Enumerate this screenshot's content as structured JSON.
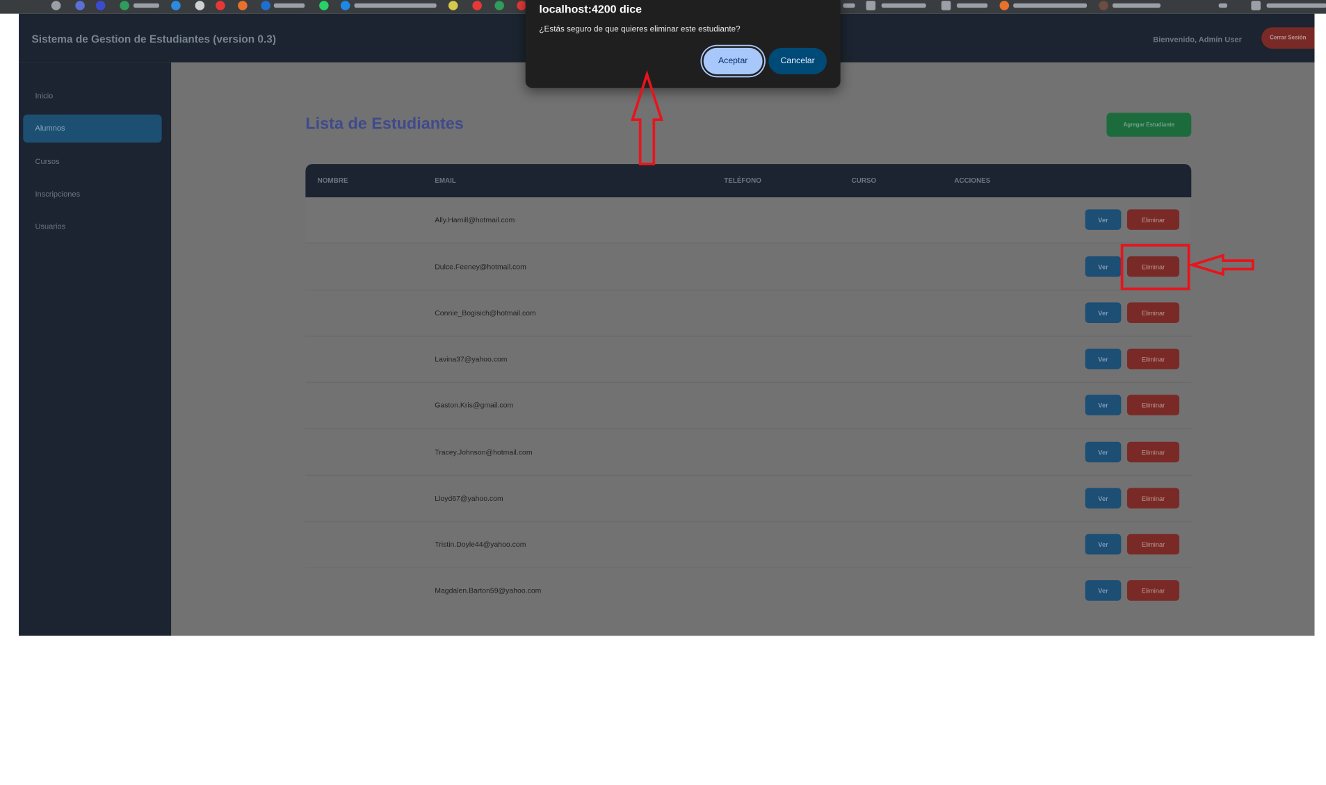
{
  "dialog": {
    "title": "localhost:4200 dice",
    "message": "¿Estás seguro de que quieres eliminar este estudiante?",
    "accept_label": "Aceptar",
    "cancel_label": "Cancelar"
  },
  "header": {
    "app_title": "Sistema de Gestion de Estudiantes (version 0.3)",
    "welcome": "Bienvenido, Admin User",
    "logout_label": "Cerrar Sesión"
  },
  "sidebar": {
    "items": [
      {
        "label": "Inicio",
        "active": false
      },
      {
        "label": "Alumnos",
        "active": true
      },
      {
        "label": "Cursos",
        "active": false
      },
      {
        "label": "Inscripciones",
        "active": false
      },
      {
        "label": "Usuarios",
        "active": false
      }
    ]
  },
  "main": {
    "title": "Lista de Estudiantes",
    "add_label": "Agregar Estudiante",
    "columns": [
      "NOMBRE",
      "EMAIL",
      "TELÉFONO",
      "CURSO",
      "ACCIONES"
    ],
    "rows": [
      {
        "email": "Ally.Hamill@hotmail.com"
      },
      {
        "email": "Dulce.Feeney@hotmail.com"
      },
      {
        "email": "Connie_Bogisich@hotmail.com"
      },
      {
        "email": "Lavina37@yahoo.com"
      },
      {
        "email": "Gaston.Kris@gmail.com"
      },
      {
        "email": "Tracey.Johnson@hotmail.com"
      },
      {
        "email": "Lloyd67@yahoo.com"
      },
      {
        "email": "Tristin.Doyle44@yahoo.com"
      },
      {
        "email": "Magdalen.Barton59@yahoo.com"
      }
    ],
    "view_label": "Ver",
    "delete_label": "Eliminar"
  },
  "colors": {
    "annotation": "#e8141b",
    "dialog_bg": "#1f1f1f",
    "accept_bg": "#a8c7fa",
    "cancel_bg": "#004a77",
    "sidebar_active": "#1d4f73",
    "delete": "#7a2a26",
    "add": "#1b6b3d"
  }
}
